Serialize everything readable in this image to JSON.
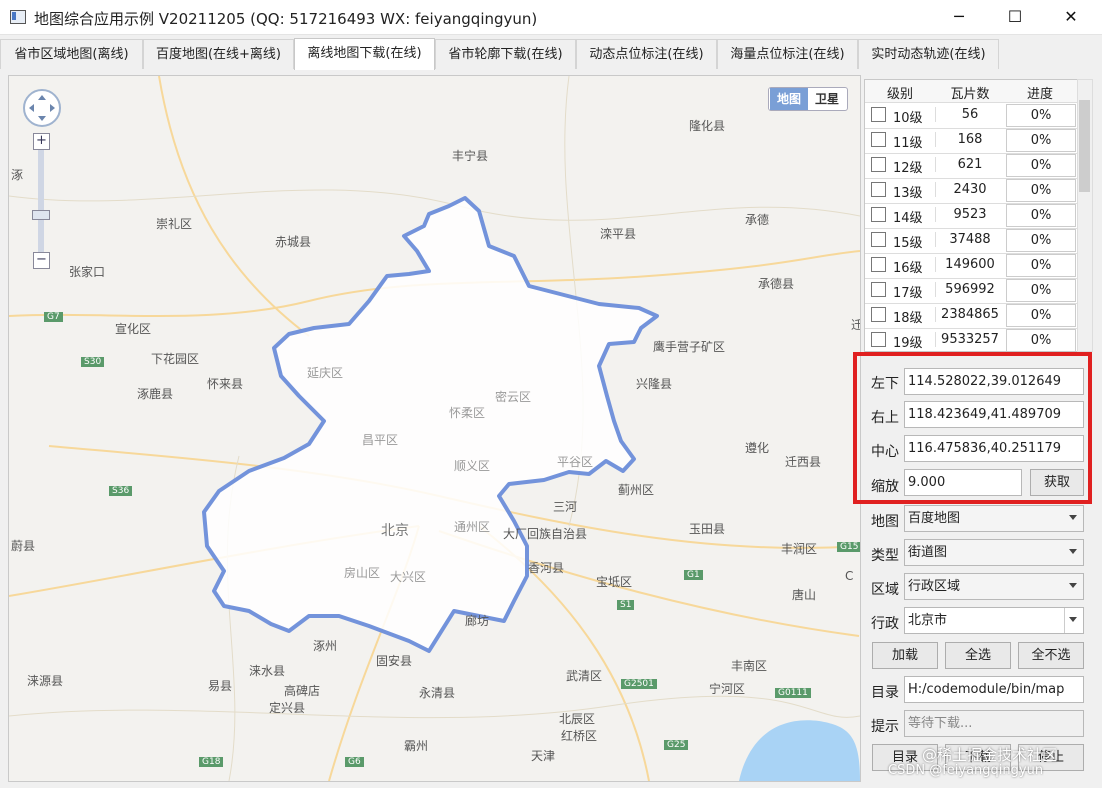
{
  "window": {
    "title": "地图综合应用示例 V20211205 (QQ: 517216493 WX: feiyangqingyun)",
    "minimize": "─",
    "maximize": "☐",
    "close": "✕"
  },
  "tabs": [
    "省市区域地图(离线)",
    "百度地图(在线+离线)",
    "离线地图下载(在线)",
    "省市轮廓下载(在线)",
    "动态点位标注(在线)",
    "海量点位标注(在线)",
    "实时动态轨迹(在线)"
  ],
  "active_tab": 2,
  "map": {
    "type_buttons": [
      "地图",
      "卫星"
    ],
    "zoom_in": "+",
    "zoom_out": "−",
    "labels": [
      "丰宁县",
      "隆化县",
      "崇礼区",
      "赤城县",
      "滦平县",
      "承德",
      "承德县",
      "张家口",
      "宣化区",
      "下花园区",
      "怀来县",
      "涿鹿县",
      "鹰手营子矿区",
      "兴隆县",
      "延庆区",
      "密云区",
      "怀柔区",
      "昌平区",
      "平谷区",
      "顺义区",
      "蓟州区",
      "遵化",
      "迁西县",
      "三河",
      "北京",
      "通州区",
      "大厂回族自治县",
      "玉田县",
      "丰润区",
      "蔚县",
      "房山区",
      "大兴区",
      "香河县",
      "宝坻区",
      "唐山",
      "涿州",
      "廊坊",
      "固安县",
      "涞水县",
      "易县",
      "高碑店",
      "定兴县",
      "永清县",
      "武清区",
      "宁河区",
      "丰南区",
      "涞源县",
      "北辰区",
      "红桥区",
      "霸州",
      "天津",
      "G18",
      "G7",
      "S30",
      "G1",
      "S1",
      "G25",
      "G2501",
      "G0111",
      "S36",
      "G15",
      "G6",
      "C",
      "涿",
      "迁"
    ]
  },
  "table": {
    "headers": [
      "级别",
      "瓦片数",
      "进度"
    ],
    "rows": [
      {
        "level": "10级",
        "count": "56",
        "progress": "0%"
      },
      {
        "level": "11级",
        "count": "168",
        "progress": "0%"
      },
      {
        "level": "12级",
        "count": "621",
        "progress": "0%"
      },
      {
        "level": "13级",
        "count": "2430",
        "progress": "0%"
      },
      {
        "level": "14级",
        "count": "9523",
        "progress": "0%"
      },
      {
        "level": "15级",
        "count": "37488",
        "progress": "0%"
      },
      {
        "level": "16级",
        "count": "149600",
        "progress": "0%"
      },
      {
        "level": "17级",
        "count": "596992",
        "progress": "0%"
      },
      {
        "level": "18级",
        "count": "2384865",
        "progress": "0%"
      },
      {
        "level": "19级",
        "count": "9533257",
        "progress": "0%"
      }
    ]
  },
  "coords": {
    "bottom_left_label": "左下",
    "bottom_left": "114.528022,39.012649",
    "top_right_label": "右上",
    "top_right": "118.423649,41.489709",
    "center_label": "中心",
    "center": "116.475836,40.251179",
    "zoom_label": "缩放",
    "zoom": "9.000",
    "fetch_button": "获取"
  },
  "options": {
    "map_label": "地图",
    "map_value": "百度地图",
    "type_label": "类型",
    "type_value": "街道图",
    "region_label": "区域",
    "region_value": "行政区域",
    "admin_label": "行政",
    "admin_value": "北京市",
    "load_button": "加载",
    "select_all_button": "全选",
    "select_none_button": "全不选",
    "dir_label": "目录",
    "dir_value": "H:/codemodule/bin/map",
    "hint_label": "提示",
    "hint_placeholder": "等待下载...",
    "dir_button": "目录",
    "download_button": "下载",
    "stop_button": "停止"
  },
  "watermark": {
    "line1": "@稀土掘金技术社区",
    "line2": "CSDN @feiyangqingyun"
  }
}
